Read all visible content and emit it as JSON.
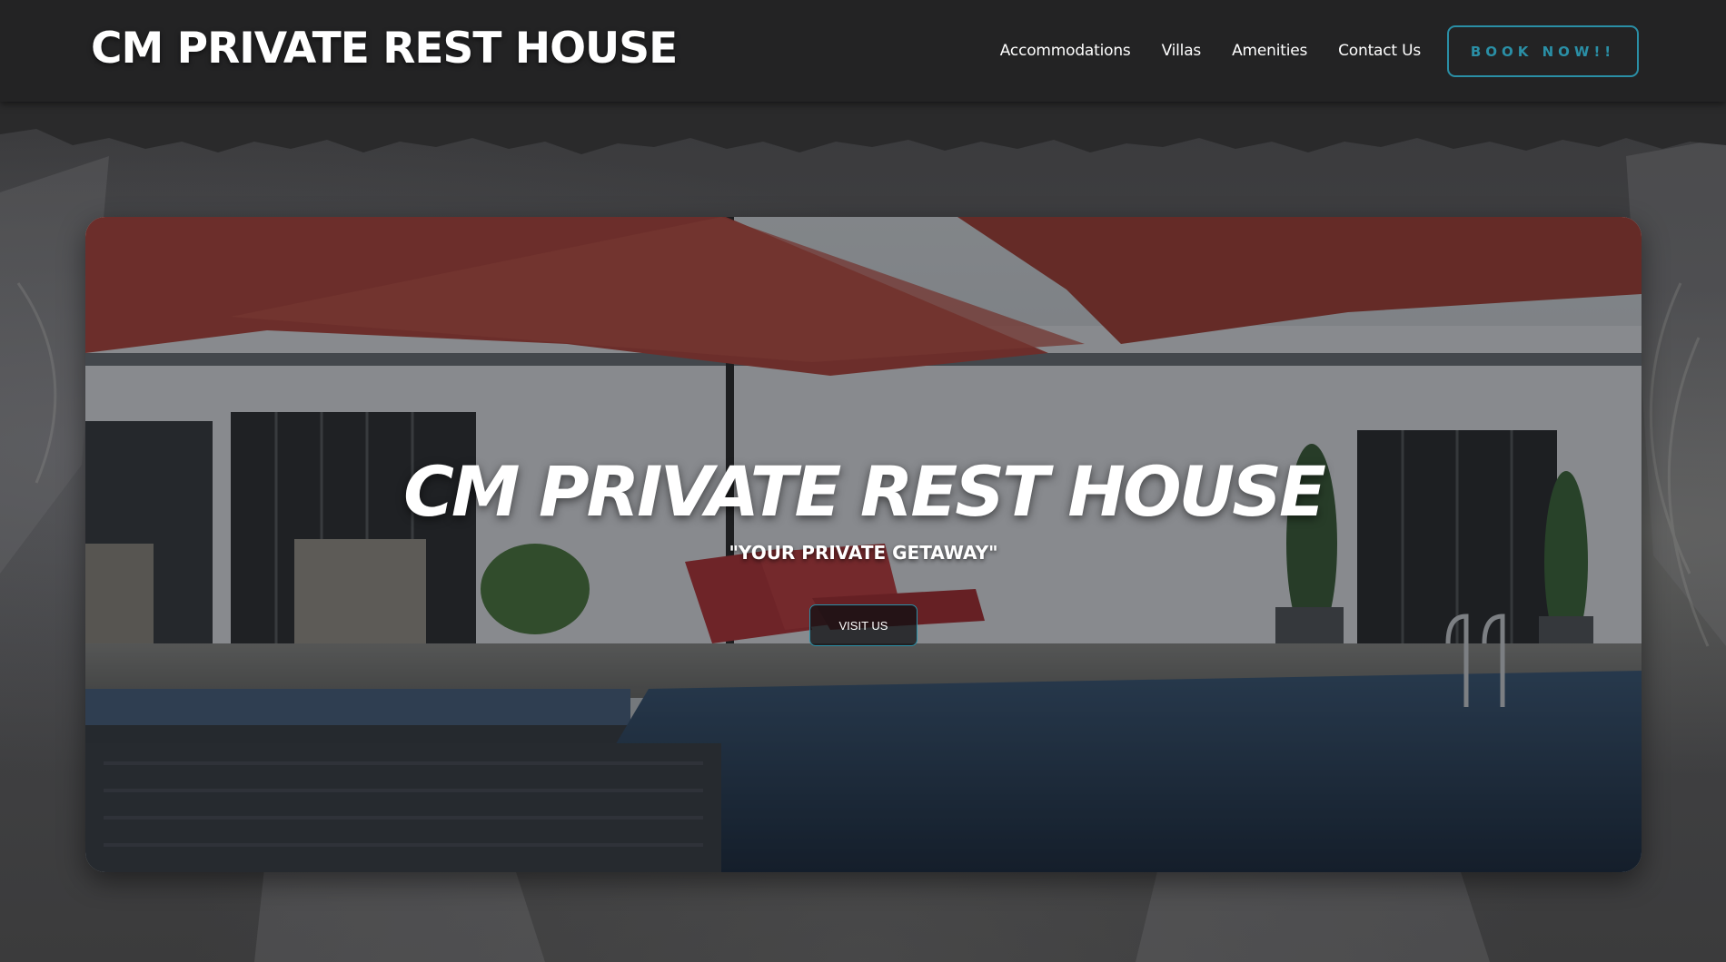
{
  "header": {
    "logo": "CM PRIVATE REST HOUSE",
    "nav": [
      "Accommodations",
      "Villas",
      "Amenities",
      "Contact Us"
    ],
    "book_button": "BOOK NOW!!"
  },
  "hero": {
    "title": "CM PRIVATE REST HOUSE",
    "subtitle": "\"YOUR PRIVATE GETAWAY\"",
    "cta": "VISIT US"
  },
  "colors": {
    "header_bg": "#232324",
    "accent": "#2a8fa6",
    "text": "#ffffff",
    "page_bg": "#3a3a3c"
  },
  "icons": []
}
